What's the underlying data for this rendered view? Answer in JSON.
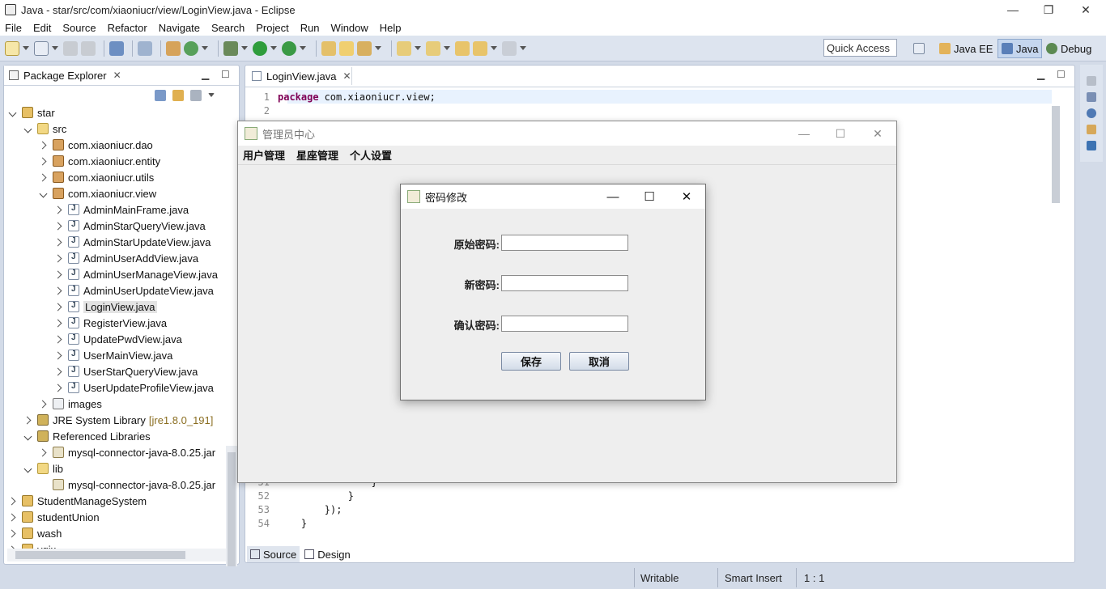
{
  "window": {
    "title": "Java - star/src/com/xiaoniucr/view/LoginView.java - Eclipse",
    "minimize_glyph": "—",
    "restore_glyph": "❐",
    "close_glyph": "✕"
  },
  "menubar": [
    "File",
    "Edit",
    "Source",
    "Refactor",
    "Navigate",
    "Search",
    "Project",
    "Run",
    "Window",
    "Help"
  ],
  "toolbar": {
    "quick_access": "Quick Access",
    "perspectives": [
      "Java EE",
      "Java",
      "Debug"
    ],
    "active_perspective": "Java"
  },
  "package_explorer": {
    "title": "Package Explorer",
    "tree": [
      {
        "label": "star",
        "icon": "project-icon",
        "depth": 0,
        "state": "open"
      },
      {
        "label": "src",
        "icon": "folder-icon",
        "depth": 1,
        "state": "open"
      },
      {
        "label": "com.xiaoniucr.dao",
        "icon": "package-icon",
        "depth": 2,
        "state": "closed"
      },
      {
        "label": "com.xiaoniucr.entity",
        "icon": "package-icon",
        "depth": 2,
        "state": "closed"
      },
      {
        "label": "com.xiaoniucr.utils",
        "icon": "package-icon",
        "depth": 2,
        "state": "closed"
      },
      {
        "label": "com.xiaoniucr.view",
        "icon": "package-icon",
        "depth": 2,
        "state": "open"
      },
      {
        "label": "AdminMainFrame.java",
        "icon": "java-file-icon",
        "depth": 3,
        "state": "closed"
      },
      {
        "label": "AdminStarQueryView.java",
        "icon": "java-file-icon",
        "depth": 3,
        "state": "closed"
      },
      {
        "label": "AdminStarUpdateView.java",
        "icon": "java-file-icon",
        "depth": 3,
        "state": "closed"
      },
      {
        "label": "AdminUserAddView.java",
        "icon": "java-file-icon",
        "depth": 3,
        "state": "closed"
      },
      {
        "label": "AdminUserManageView.java",
        "icon": "java-file-icon",
        "depth": 3,
        "state": "closed"
      },
      {
        "label": "AdminUserUpdateView.java",
        "icon": "java-file-icon",
        "depth": 3,
        "state": "closed"
      },
      {
        "label": "LoginView.java",
        "icon": "java-file-icon",
        "depth": 3,
        "state": "closed",
        "selected": true
      },
      {
        "label": "RegisterView.java",
        "icon": "java-file-icon",
        "depth": 3,
        "state": "closed"
      },
      {
        "label": "UpdatePwdView.java",
        "icon": "java-file-icon",
        "depth": 3,
        "state": "closed"
      },
      {
        "label": "UserMainView.java",
        "icon": "java-file-icon",
        "depth": 3,
        "state": "closed"
      },
      {
        "label": "UserStarQueryView.java",
        "icon": "java-file-icon",
        "depth": 3,
        "state": "closed"
      },
      {
        "label": "UserUpdateProfileView.java",
        "icon": "java-file-icon",
        "depth": 3,
        "state": "closed"
      },
      {
        "label": "images",
        "icon": "images-folder-icon",
        "depth": 2,
        "state": "closed"
      },
      {
        "label": "JRE System Library",
        "icon": "library-icon",
        "depth": 1,
        "state": "closed",
        "decoration": "[jre1.8.0_191]"
      },
      {
        "label": "Referenced Libraries",
        "icon": "library-icon",
        "depth": 1,
        "state": "open"
      },
      {
        "label": "mysql-connector-java-8.0.25.jar",
        "icon": "jar-icon",
        "depth": 2,
        "state": "closed"
      },
      {
        "label": "lib",
        "icon": "folder-icon",
        "depth": 1,
        "state": "open"
      },
      {
        "label": "mysql-connector-java-8.0.25.jar",
        "icon": "jar-icon",
        "depth": 2,
        "state": "none"
      },
      {
        "label": "StudentManageSystem",
        "icon": "project-icon",
        "depth": 0,
        "state": "closed"
      },
      {
        "label": "studentUnion",
        "icon": "project-icon",
        "depth": 0,
        "state": "closed"
      },
      {
        "label": "wash",
        "icon": "project-icon",
        "depth": 0,
        "state": "closed"
      },
      {
        "label": "yqix",
        "icon": "project-icon",
        "depth": 0,
        "state": "closed"
      }
    ]
  },
  "editor": {
    "tab": "LoginView.java",
    "lines": [
      {
        "num": "1",
        "keyword": "package",
        "text": "com.xiaoniucr.view;"
      },
      {
        "num": "2",
        "keyword": "",
        "text": ""
      },
      {
        "num": "51",
        "keyword": "",
        "text": "                }"
      },
      {
        "num": "52",
        "keyword": "",
        "text": "            }"
      },
      {
        "num": "53",
        "keyword": "",
        "text": "        });"
      },
      {
        "num": "54",
        "keyword": "",
        "text": "    }"
      }
    ],
    "bottom_tabs": [
      "Source",
      "Design"
    ],
    "active_bottom_tab": "Source"
  },
  "status": {
    "writable": "Writable",
    "insert_mode": "Smart Insert",
    "position": "1 : 1"
  },
  "swing_frame": {
    "title": "管理员中心",
    "menus": [
      "用户管理",
      "星座管理",
      "个人设置"
    ],
    "minimize_glyph": "—",
    "maximize_glyph": "☐",
    "close_glyph": "✕"
  },
  "dialog": {
    "title": "密码修改",
    "fields": [
      {
        "label": "原始密码:",
        "value": ""
      },
      {
        "label": "新密码:",
        "value": ""
      },
      {
        "label": "确认密码:",
        "value": ""
      }
    ],
    "save_label": "保存",
    "cancel_label": "取消",
    "minimize_glyph": "—",
    "maximize_glyph": "☐",
    "close_glyph": "✕"
  }
}
